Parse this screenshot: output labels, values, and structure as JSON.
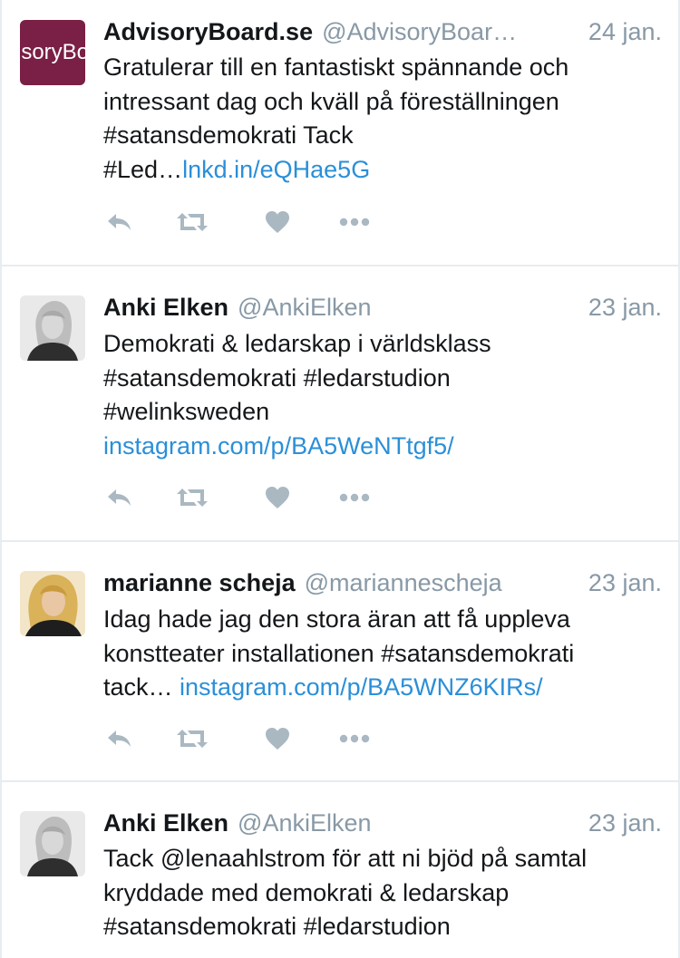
{
  "tweets": [
    {
      "name": "AdvisoryBoard.se",
      "handle": "@AdvisoryBoar…",
      "time": "24 jan.",
      "avatar_text": "isoryBo",
      "avatar_color": "#7a1f45",
      "lines": [
        {
          "text": "Gratulerar till en fantastiskt spännande och",
          "link": ""
        },
        {
          "text": "intressant dag och kväll på föreställningen",
          "link": ""
        },
        {
          "text": "#satansdemokrati  Tack",
          "link": ""
        },
        {
          "text": "#Led…",
          "link": "lnkd.in/eQHae5G"
        }
      ]
    },
    {
      "name": "Anki Elken",
      "handle": "@AnkiElken",
      "time": "23 jan.",
      "lines": [
        {
          "text": "Demokrati & ledarskap i världsklass",
          "link": ""
        },
        {
          "text": "#satansdemokrati #ledarstudion",
          "link": ""
        },
        {
          "text": "#welinksweden",
          "link": ""
        },
        {
          "text": "",
          "link": "instagram.com/p/BA5WeNTtgf5/"
        }
      ]
    },
    {
      "name": "marianne scheja",
      "handle": "@mariannescheja",
      "time": "23 jan.",
      "lines": [
        {
          "text": "Idag hade jag den stora äran att få uppleva",
          "link": ""
        },
        {
          "text": "konstteater installationen #satansdemokrati",
          "link": ""
        },
        {
          "text": "tack… ",
          "link": "instagram.com/p/BA5WNZ6KIRs/"
        }
      ]
    },
    {
      "name": "Anki Elken",
      "handle": "@AnkiElken",
      "time": "23 jan.",
      "lines": [
        {
          "text": "Tack @lenaahlstrom för att ni bjöd på samtal",
          "link": ""
        },
        {
          "text": "kryddade med demokrati & ledarskap",
          "link": ""
        },
        {
          "text": "#satansdemokrati #ledarstudion",
          "link": ""
        }
      ]
    }
  ],
  "colors": {
    "link": "#2b8fd8",
    "secondary_text": "#8899a6",
    "action_icon": "#aab8c2",
    "divider": "#e6ecf0"
  },
  "icons": {
    "reply": "reply-icon",
    "retweet": "retweet-icon",
    "like": "heart-icon",
    "more": "more-icon"
  }
}
